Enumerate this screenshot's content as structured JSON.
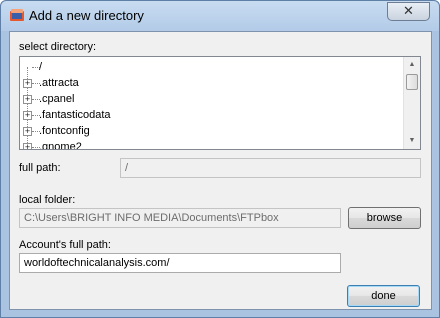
{
  "window": {
    "title": "Add a new directory",
    "close_label": "✕"
  },
  "select_directory": {
    "label": "select directory:",
    "items": [
      {
        "label": "/",
        "expandable": false
      },
      {
        "label": ".attracta",
        "expandable": true
      },
      {
        "label": ".cpanel",
        "expandable": true
      },
      {
        "label": ".fantasticodata",
        "expandable": true
      },
      {
        "label": ".fontconfig",
        "expandable": true
      },
      {
        "label": ".gnome2",
        "expandable": true
      }
    ]
  },
  "full_path": {
    "label": "full path:",
    "value": "/"
  },
  "local_folder": {
    "label": "local folder:",
    "value": "C:\\Users\\BRIGHT INFO MEDIA\\Documents\\FTPbox",
    "browse_label": "browse"
  },
  "account_path": {
    "label": "Account's full path:",
    "value": "worldoftechnicalanalysis.com/"
  },
  "done_label": "done",
  "colors": {
    "title_bar": "#b9cfe9",
    "client_bg": "#f0f0f0",
    "default_button_border": "#3c7fb1"
  }
}
